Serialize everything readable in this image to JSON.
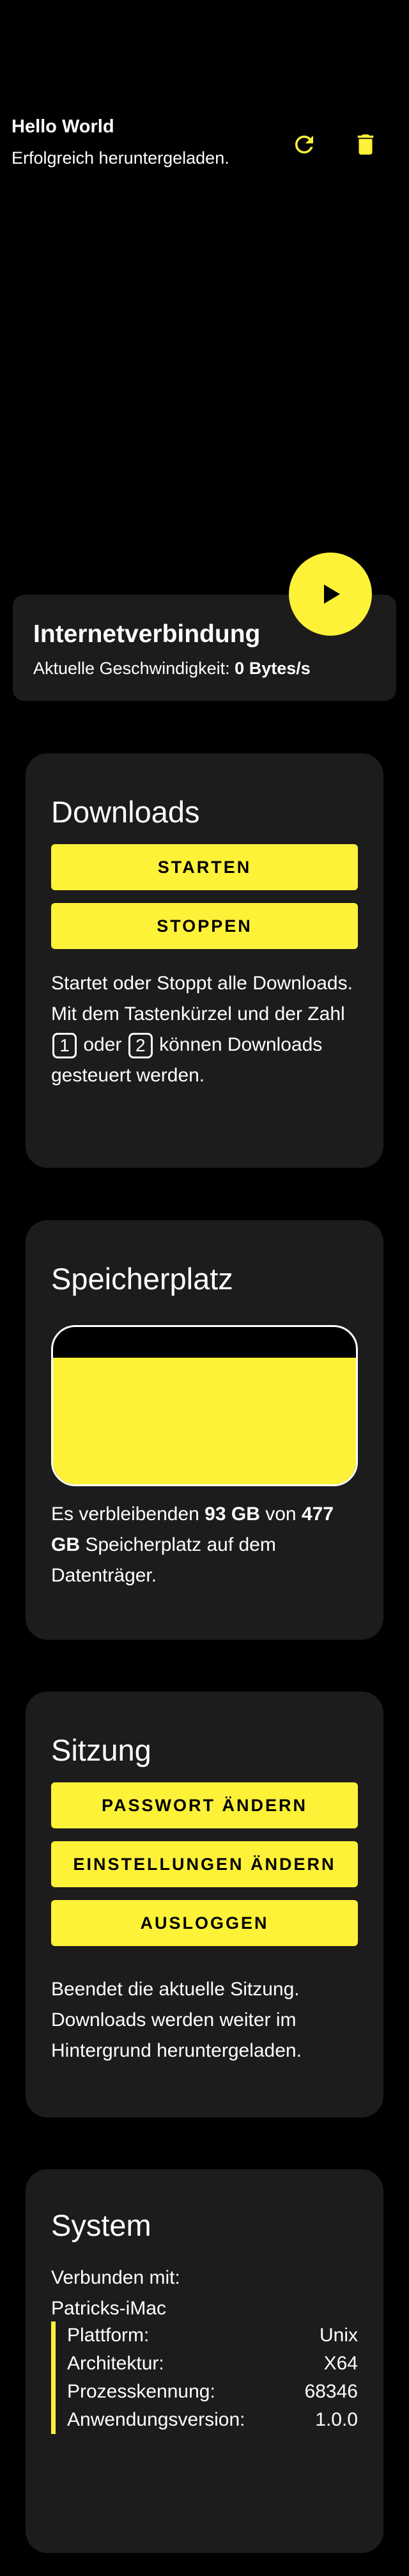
{
  "download": {
    "title": "Hello World",
    "status": "Erfolgreich heruntergeladen.",
    "refresh_icon": "refresh-icon",
    "delete_icon": "trash-icon"
  },
  "internet": {
    "title": "Internetverbindung",
    "speed_label": "Aktuelle Geschwindigkeit:",
    "speed_value": "0 Bytes/s",
    "play_icon": "play-icon"
  },
  "downloads_card": {
    "title": "Downloads",
    "start_label": "STARTEN",
    "stop_label": "STOPPEN",
    "text_1": "Startet oder Stoppt alle Downloads. Mit dem Tastenkürzel und der Zahl",
    "key_1": "1",
    "text_2": "oder",
    "key_2": "2",
    "text_3": "können Downloads gesteuert werden."
  },
  "storage_card": {
    "title": "Speicherplatz",
    "used_fraction": 0.805,
    "text_1": "Es verbleibenden",
    "free": "93 GB",
    "text_2": "von",
    "total": "477 GB",
    "text_3": "Speicherplatz auf dem Datenträger."
  },
  "session_card": {
    "title": "Sitzung",
    "change_password_label": "PASSWORT ÄNDERN",
    "change_settings_label": "EINSTELLUNGEN ÄNDERN",
    "logout_label": "AUSLOGGEN",
    "description": "Beendet die aktuelle Sitzung. Downloads werden weiter im Hintergrund heruntergeladen."
  },
  "system_card": {
    "title": "System",
    "connected_label": "Verbunden mit:",
    "connected_host": "Patricks-iMac",
    "rows": [
      {
        "label": "Plattform:",
        "value": "Unix"
      },
      {
        "label": "Architektur:",
        "value": "X64"
      },
      {
        "label": "Prozesskennung:",
        "value": "68346"
      },
      {
        "label": "Anwendungsversion:",
        "value": "1.0.0"
      }
    ]
  },
  "colors": {
    "accent": "#FEF238",
    "card_bg": "#1c1c1c",
    "page_bg": "#000000"
  }
}
